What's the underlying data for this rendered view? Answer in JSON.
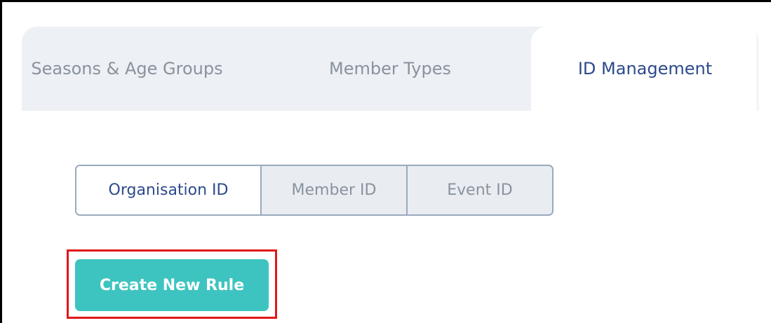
{
  "tabs": [
    {
      "label": "Seasons & Age Groups",
      "active": false
    },
    {
      "label": "Member Types",
      "active": false
    },
    {
      "label": "ID Management",
      "active": true
    }
  ],
  "id_types": [
    {
      "label": "Organisation ID",
      "active": true
    },
    {
      "label": "Member ID",
      "active": false
    },
    {
      "label": "Event ID",
      "active": false
    }
  ],
  "actions": {
    "create_label": "Create New Rule"
  },
  "colors": {
    "accent_text": "#2c4a8c",
    "button": "#3ec4c0",
    "highlight": "#e0181c",
    "tab_bg": "#edf0f4"
  }
}
